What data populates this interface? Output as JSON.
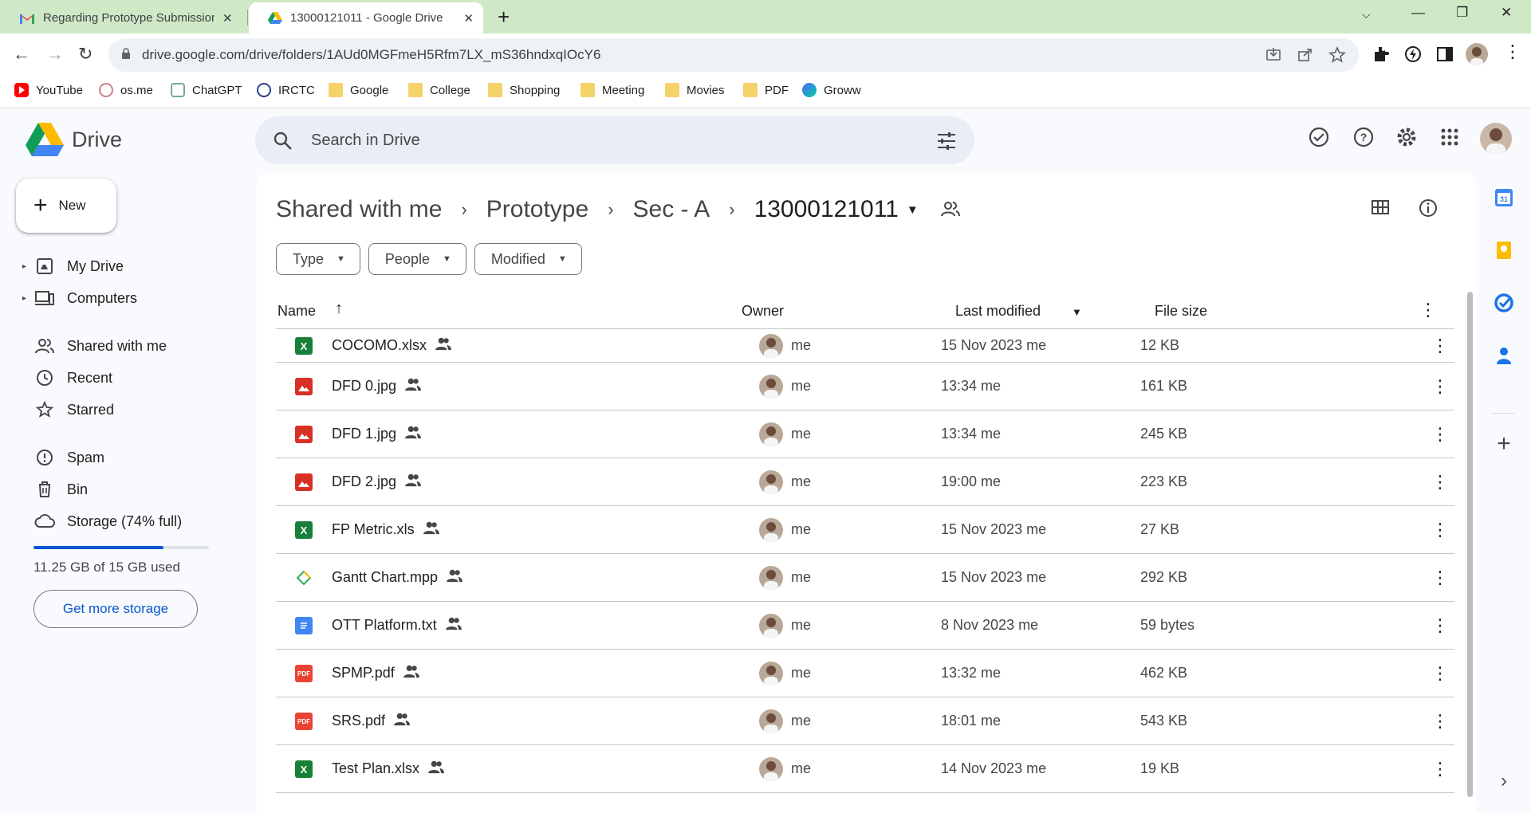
{
  "browser": {
    "tabs": [
      {
        "title": "Regarding Prototype Submission",
        "active": false
      },
      {
        "title": "13000121011 - Google Drive",
        "active": true
      }
    ],
    "url": "drive.google.com/drive/folders/1AUd0MGFmeH5Rfm7LX_mS36hndxqIOcY6",
    "bookmarks": [
      "YouTube",
      "os.me",
      "ChatGPT",
      "IRCTC",
      "Google",
      "College",
      "Shopping",
      "Meeting",
      "Movies",
      "PDF",
      "Groww"
    ]
  },
  "drive": {
    "logo": "Drive",
    "search_placeholder": "Search in Drive",
    "new_label": "New",
    "nav": {
      "my_drive": "My Drive",
      "computers": "Computers",
      "shared": "Shared with me",
      "recent": "Recent",
      "starred": "Starred",
      "spam": "Spam",
      "bin": "Bin",
      "storage": "Storage (74% full)"
    },
    "storage_used_fraction": 0.74,
    "storage_text": "11.25 GB of 15 GB used",
    "get_storage": "Get more storage",
    "breadcrumb": [
      "Shared with me",
      "Prototype",
      "Sec - A",
      "13000121011"
    ],
    "filters": [
      "Type",
      "People",
      "Modified"
    ],
    "columns": {
      "name": "Name",
      "owner": "Owner",
      "modified": "Last modified",
      "size": "File size"
    },
    "files": [
      {
        "name": "COCOMO.xlsx",
        "type": "sheet",
        "owner": "me",
        "modified": "15 Nov 2023 me",
        "size": "12 KB"
      },
      {
        "name": "DFD 0.jpg",
        "type": "image",
        "owner": "me",
        "modified": "13:34 me",
        "size": "161 KB"
      },
      {
        "name": "DFD 1.jpg",
        "type": "image",
        "owner": "me",
        "modified": "13:34 me",
        "size": "245 KB"
      },
      {
        "name": "DFD 2.jpg",
        "type": "image",
        "owner": "me",
        "modified": "19:00 me",
        "size": "223 KB"
      },
      {
        "name": "FP Metric.xls",
        "type": "sheet",
        "owner": "me",
        "modified": "15 Nov 2023 me",
        "size": "27 KB"
      },
      {
        "name": "Gantt Chart.mpp",
        "type": "project",
        "owner": "me",
        "modified": "15 Nov 2023 me",
        "size": "292 KB"
      },
      {
        "name": "OTT Platform.txt",
        "type": "doc",
        "owner": "me",
        "modified": "8 Nov 2023 me",
        "size": "59 bytes"
      },
      {
        "name": "SPMP.pdf",
        "type": "pdf",
        "owner": "me",
        "modified": "13:32 me",
        "size": "462 KB"
      },
      {
        "name": "SRS.pdf",
        "type": "pdf",
        "owner": "me",
        "modified": "18:01 me",
        "size": "543 KB"
      },
      {
        "name": "Test Plan.xlsx",
        "type": "sheet",
        "owner": "me",
        "modified": "14 Nov 2023 me",
        "size": "19 KB"
      }
    ],
    "colors": {
      "sheet": "#188038",
      "image": "#d93025",
      "pdf": "#ea4335",
      "doc": "#4285f4",
      "project": "#34a853"
    }
  }
}
